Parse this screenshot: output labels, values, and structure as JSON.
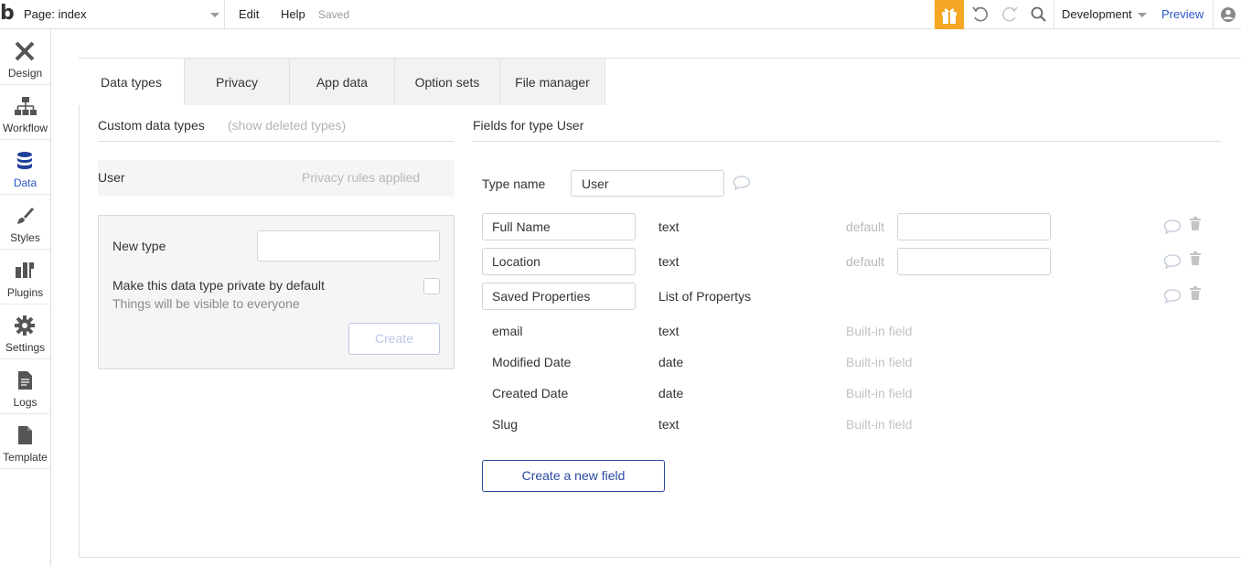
{
  "topbar": {
    "logo": "b",
    "page_select": "Page: index",
    "menu": {
      "edit": "Edit",
      "help": "Help",
      "status": "Saved"
    },
    "environment": "Development",
    "preview": "Preview",
    "gift_color": "#f5a623"
  },
  "sidebar": {
    "items": [
      {
        "label": "Design",
        "icon": "design-icon"
      },
      {
        "label": "Workflow",
        "icon": "workflow-icon"
      },
      {
        "label": "Data",
        "icon": "database-icon",
        "active": true
      },
      {
        "label": "Styles",
        "icon": "brush-icon"
      },
      {
        "label": "Plugins",
        "icon": "plugin-icon"
      },
      {
        "label": "Settings",
        "icon": "gear-icon"
      },
      {
        "label": "Logs",
        "icon": "document-icon"
      },
      {
        "label": "Template",
        "icon": "template-icon"
      }
    ]
  },
  "tabs": [
    {
      "label": "Data types",
      "active": true
    },
    {
      "label": "Privacy"
    },
    {
      "label": "App data"
    },
    {
      "label": "Option sets"
    },
    {
      "label": "File manager"
    }
  ],
  "left": {
    "title": "Custom data types",
    "show_deleted": "(show deleted types)",
    "types": [
      {
        "name": "User",
        "status": "Privacy rules applied"
      }
    ],
    "new_type": {
      "label": "New type",
      "private_label": "Make this data type private by default",
      "private_hint": "Things will be visible to everyone",
      "create": "Create"
    }
  },
  "right": {
    "title": "Fields for type User",
    "type_name_label": "Type name",
    "type_name_value": "User",
    "custom_fields": [
      {
        "name": "Full Name",
        "type": "text",
        "default_label": "default"
      },
      {
        "name": "Location",
        "type": "text",
        "default_label": "default"
      },
      {
        "name": "Saved Properties",
        "type": "List of Propertys"
      }
    ],
    "builtin_fields": [
      {
        "name": "email",
        "type": "text",
        "note": "Built-in field"
      },
      {
        "name": "Modified Date",
        "type": "date",
        "note": "Built-in field"
      },
      {
        "name": "Created Date",
        "type": "date",
        "note": "Built-in field"
      },
      {
        "name": "Slug",
        "type": "text",
        "note": "Built-in field"
      }
    ],
    "create_field": "Create a new field"
  },
  "colors": {
    "accent": "#2a57c9",
    "button_border": "#2a4aa0"
  }
}
